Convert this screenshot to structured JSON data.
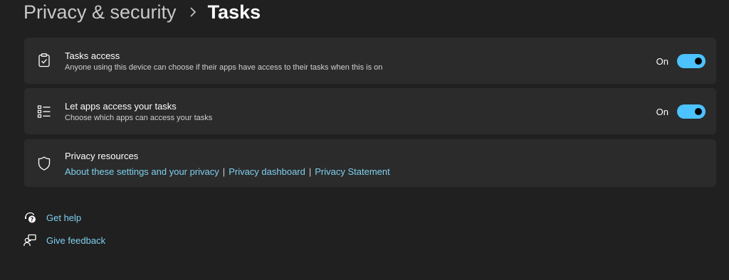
{
  "breadcrumb": {
    "parent": "Privacy & security",
    "separator": "›",
    "current": "Tasks"
  },
  "settings": [
    {
      "icon": "clipboard-check-icon",
      "title": "Tasks access",
      "subtitle": "Anyone using this device can choose if their apps have access to their tasks when this is on",
      "state_label": "On",
      "enabled": true
    },
    {
      "icon": "task-list-icon",
      "title": "Let apps access your tasks",
      "subtitle": "Choose which apps can access your tasks",
      "state_label": "On",
      "enabled": true
    }
  ],
  "privacy_resources": {
    "icon": "shield-icon",
    "title": "Privacy resources",
    "links": [
      "About these settings and your privacy",
      "Privacy dashboard",
      "Privacy Statement"
    ],
    "separator": "|"
  },
  "help": {
    "get_help": {
      "icon": "get-help-icon",
      "label": "Get help"
    },
    "give_feedback": {
      "icon": "feedback-icon",
      "label": "Give feedback"
    }
  },
  "colors": {
    "background": "#202020",
    "card": "#2b2b2b",
    "accent": "#4cc2ff",
    "link": "#7fd0ef"
  }
}
